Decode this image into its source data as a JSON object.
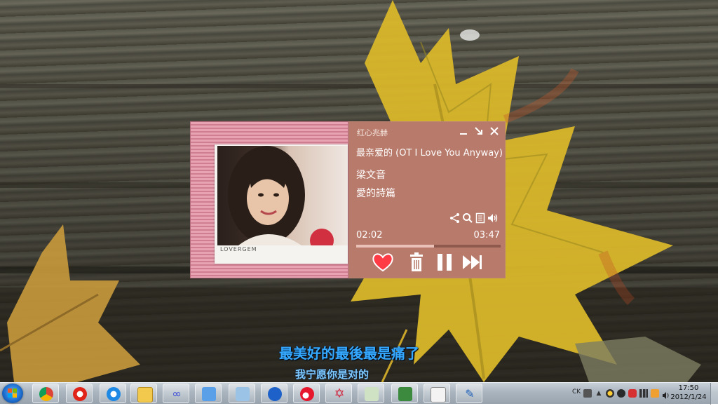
{
  "player": {
    "channel": "红心兆赫",
    "song": "最亲爱的 (OT I Love You Anyway)",
    "artist": "梁文音",
    "album": "愛的詩篇",
    "elapsed": "02:02",
    "total": "03:47",
    "progress": 0.54,
    "cover_brand": "LOVERGEM",
    "colors": {
      "panel": "#b87a6a",
      "frame": "#e7a3b2",
      "heart": "#ff3b46"
    },
    "icons": [
      "minimize-icon",
      "shrink-icon",
      "close-icon",
      "share-icon",
      "search-icon",
      "lyrics-icon",
      "volume-icon",
      "heart-icon",
      "trash-icon",
      "pause-icon",
      "next-icon"
    ]
  },
  "lyrics": {
    "line1": "最美好的最後最是痛了",
    "line2": "我宁愿你是对的"
  },
  "taskbar": {
    "apps": [
      "chrome",
      "opera",
      "internet-explorer",
      "file-explorer",
      "infinity-app",
      "photo-app",
      "window-app",
      "launcher-app",
      "weibo",
      "star-app",
      "explorer-window",
      "chart-app",
      "editor-app"
    ],
    "tray": {
      "ime": "CK"
    },
    "clock": {
      "time": "17:50",
      "date": "2012/1/24"
    }
  }
}
